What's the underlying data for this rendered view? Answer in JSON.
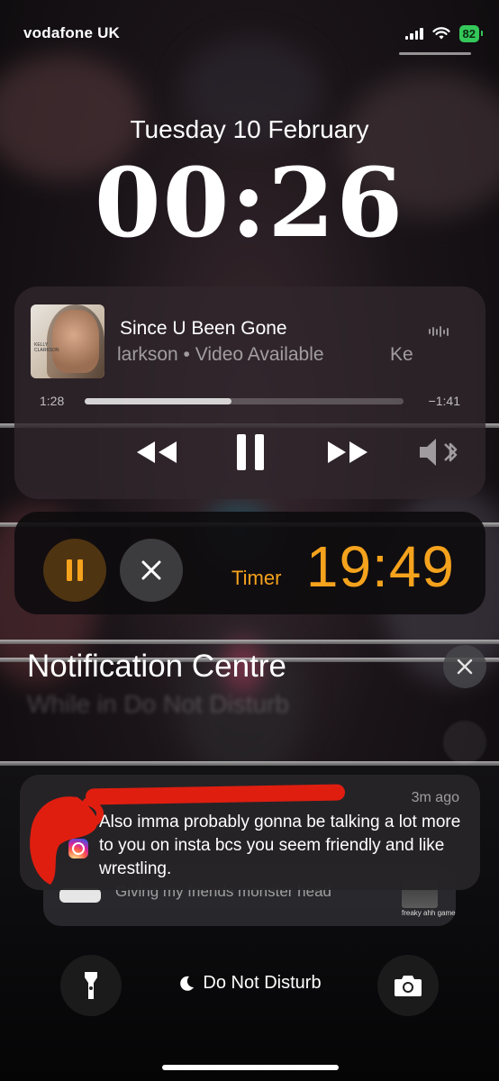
{
  "status": {
    "carrier": "vodafone UK",
    "battery": "82"
  },
  "lock": {
    "date": "Tuesday 10 February",
    "time": "00:26"
  },
  "music": {
    "title": "Since U Been Gone",
    "subtitle": "larkson • Video Available",
    "subtitle_scroll": "Ke",
    "album_text": "KELLY CLARKSON",
    "elapsed": "1:28",
    "remaining": "−1:41",
    "progress": 0.46
  },
  "timer": {
    "label": "Timer",
    "value": "19:49"
  },
  "notification_centre": {
    "title": "Notification Centre",
    "dnd_ghost": "While in Do Not Disturb"
  },
  "notification": {
    "time": "3m ago",
    "body": "Also imma probably gonna be talking a lot more to you on insta bcs you seem friendly and like wrestling."
  },
  "stacked": {
    "text": "Giving my friends monster head",
    "thumb_caption": "freaky ahh game"
  },
  "bottom": {
    "dnd_label": "Do Not Disturb"
  },
  "colors": {
    "accent": "#f5a21d",
    "battery": "#34c759",
    "redact": "#e01e10"
  }
}
